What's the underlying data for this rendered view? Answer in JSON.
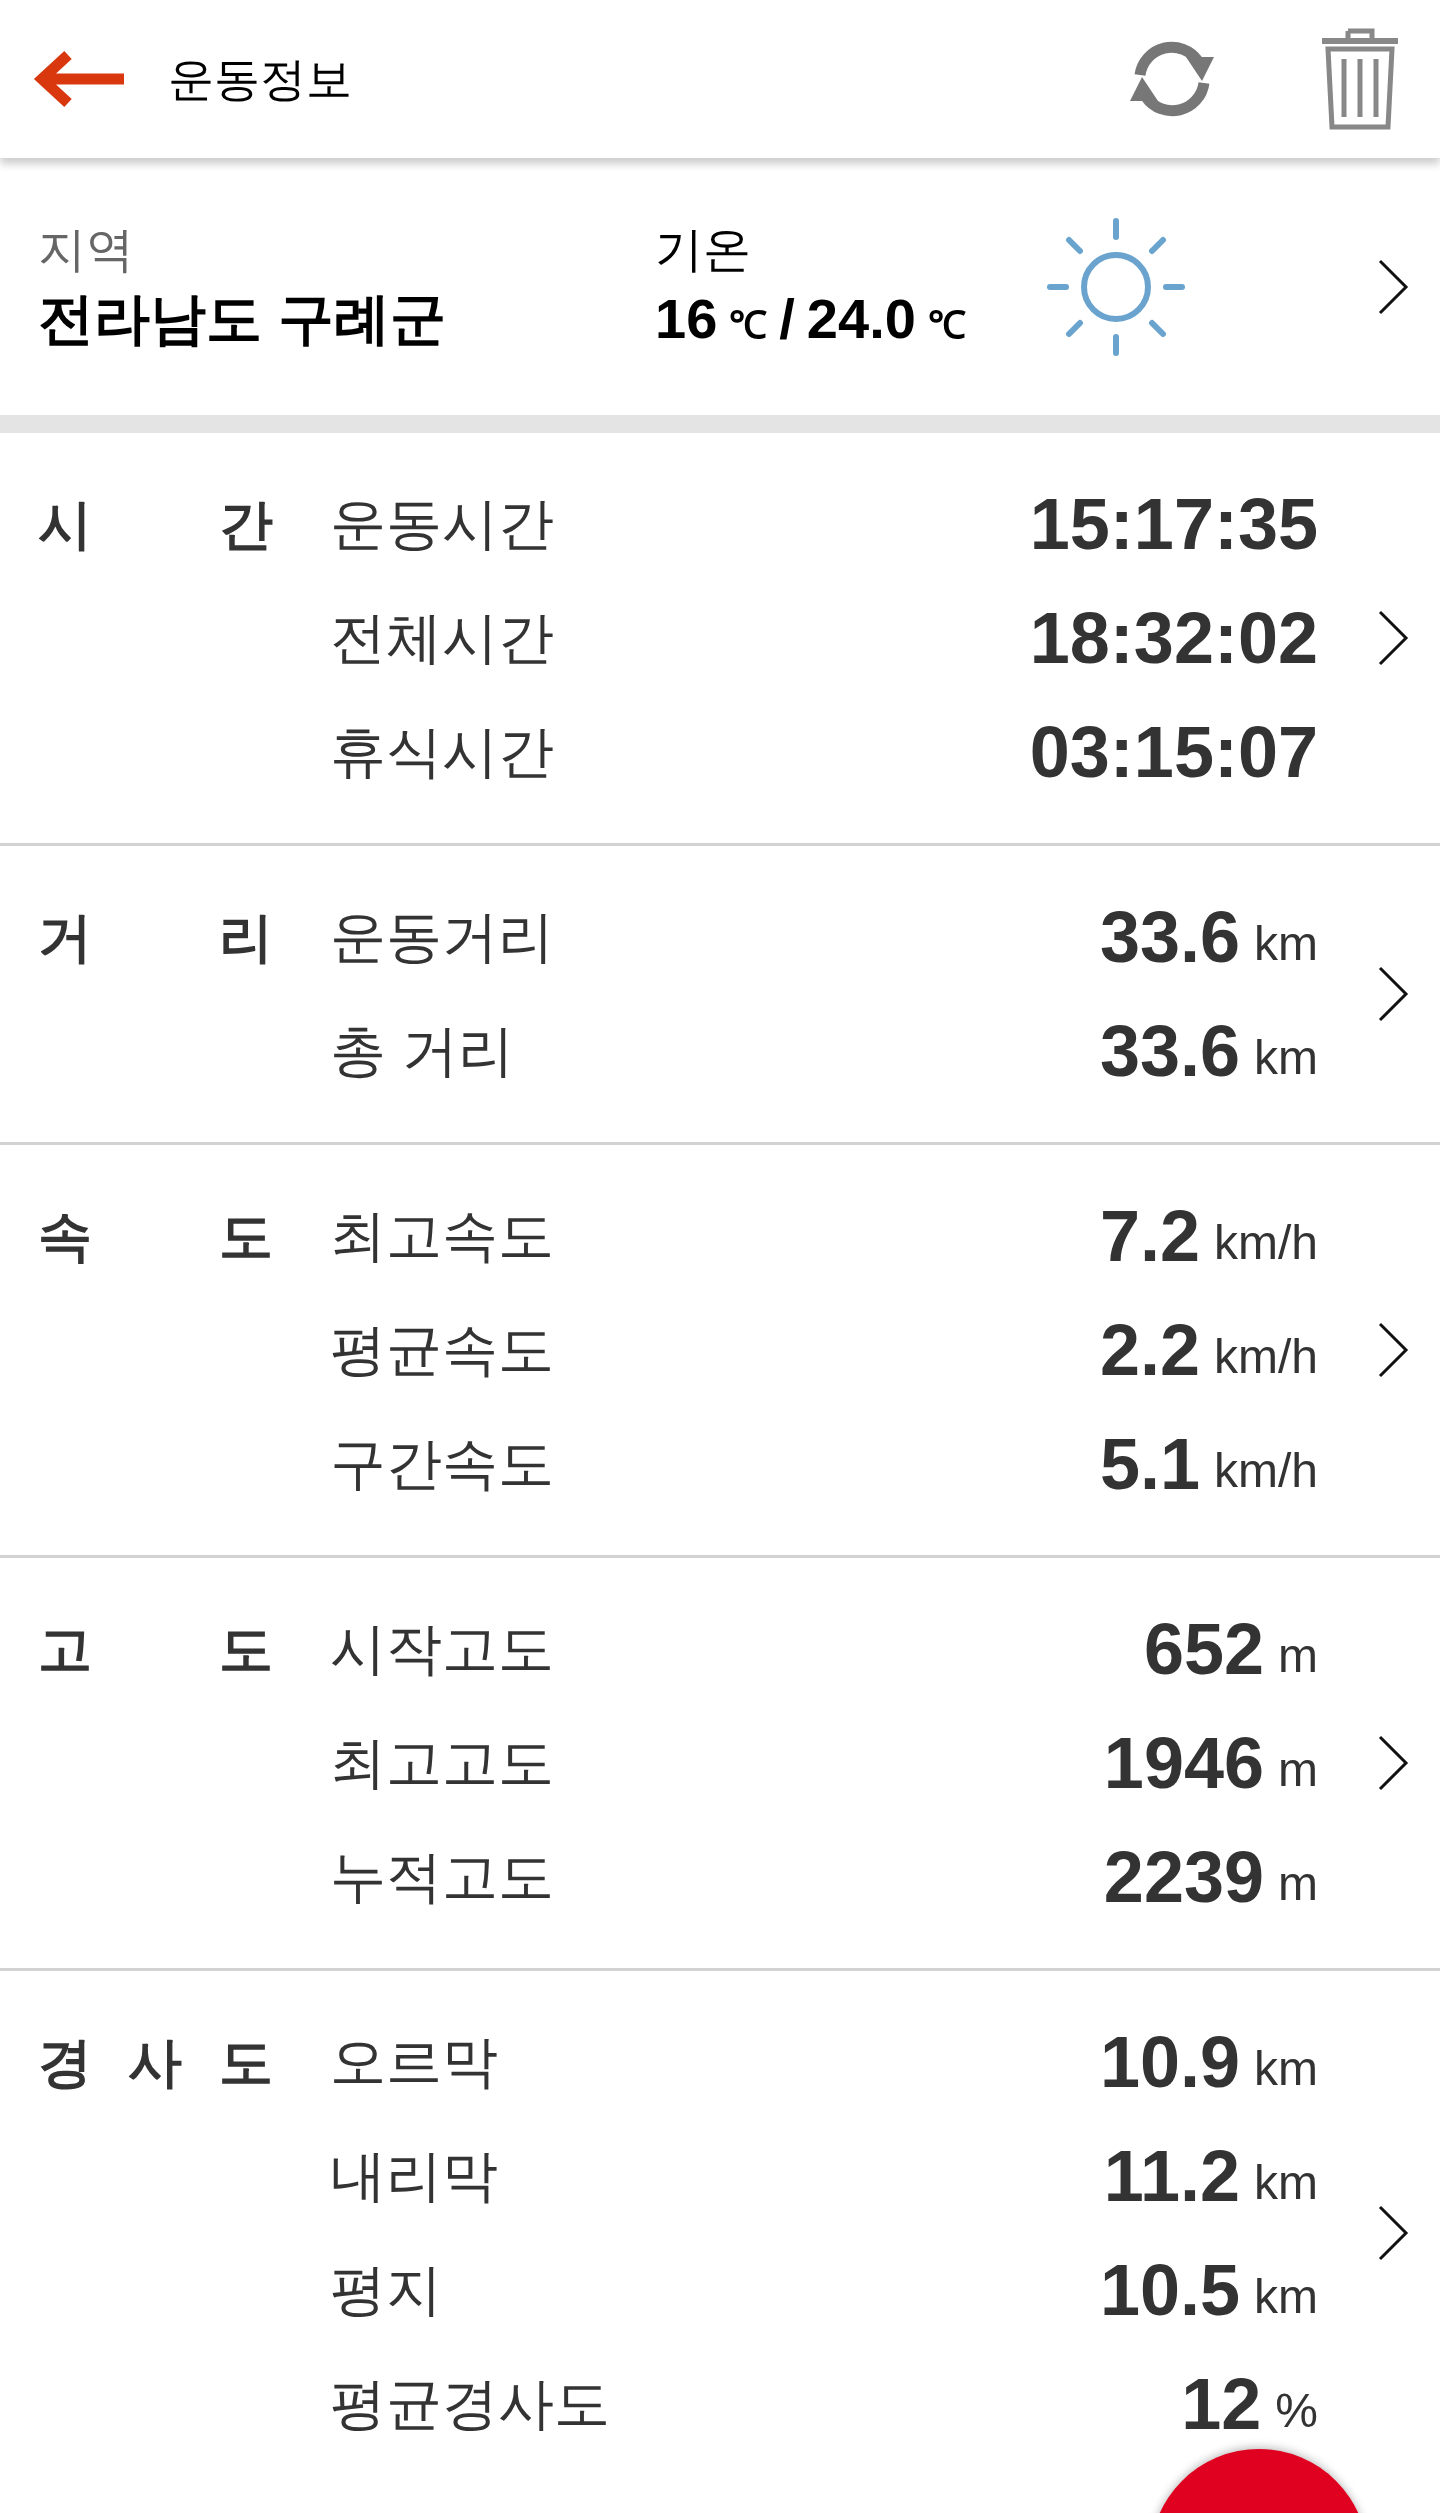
{
  "header": {
    "title": "운동정보"
  },
  "summary": {
    "region_label": "지역",
    "region": "전라남도 구례군",
    "temp_label": "기온",
    "temp_low": "16",
    "temp_low_unit": "℃",
    "temp_separator": "/",
    "temp_high": "24.0",
    "temp_high_unit": "℃"
  },
  "sections": [
    {
      "label": "시 간",
      "rows": [
        {
          "label": "운동시간",
          "value": "15:17:35"
        },
        {
          "label": "전체시간",
          "value": "18:32:02"
        },
        {
          "label": "휴식시간",
          "value": "03:15:07"
        }
      ]
    },
    {
      "label": "거 리",
      "rows": [
        {
          "label": "운동거리",
          "value": "33.6",
          "unit": "km"
        },
        {
          "label": "총 거리",
          "value": "33.6",
          "unit": "km"
        }
      ]
    },
    {
      "label": "속 도",
      "rows": [
        {
          "label": "최고속도",
          "value": "7.2",
          "unit": "km/h"
        },
        {
          "label": "평균속도",
          "value": "2.2",
          "unit": "km/h"
        },
        {
          "label": "구간속도",
          "value": "5.1",
          "unit": "km/h"
        }
      ]
    },
    {
      "label": "고 도",
      "rows": [
        {
          "label": "시작고도",
          "value": "652",
          "unit": "m"
        },
        {
          "label": "최고고도",
          "value": "1946",
          "unit": "m"
        },
        {
          "label": "누적고도",
          "value": "2239",
          "unit": "m"
        }
      ]
    },
    {
      "label": "경 사 도",
      "rows": [
        {
          "label": "오르막",
          "value": "10.9",
          "unit": "km"
        },
        {
          "label": "내리막",
          "value": "11.2",
          "unit": "km"
        },
        {
          "label": "평지",
          "value": "10.5",
          "unit": "km"
        },
        {
          "label": "평균경사도",
          "value": "12",
          "unit": "%"
        }
      ]
    }
  ]
}
